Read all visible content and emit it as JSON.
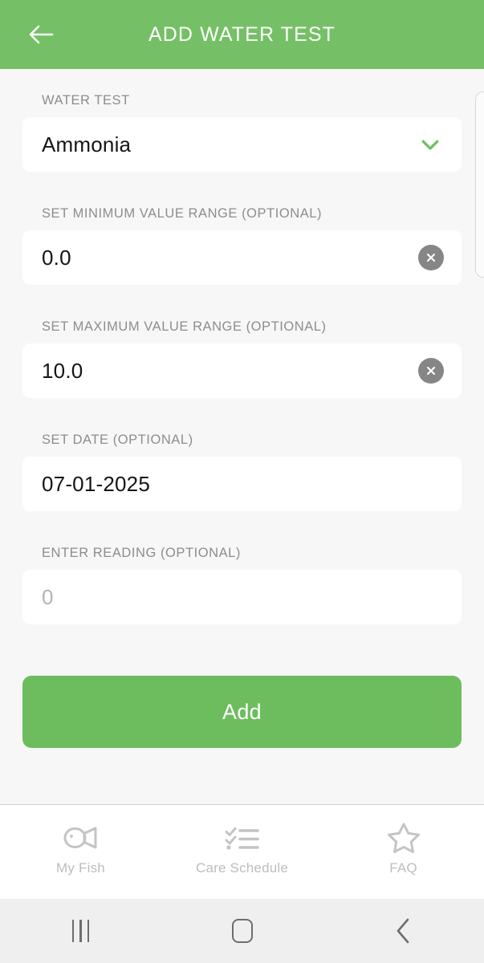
{
  "header": {
    "title": "ADD WATER TEST",
    "back_icon": "arrow-left-icon",
    "background_color": "#75c066"
  },
  "form": {
    "water_test": {
      "label": "WATER TEST",
      "value": "Ammonia",
      "dropdown_icon": "chevron-down-icon",
      "dropdown_icon_color": "#6dbd5f"
    },
    "min_value": {
      "label": "SET MINIMUM VALUE RANGE (OPTIONAL)",
      "value": "0.0",
      "clear_icon": "clear-circle-icon"
    },
    "max_value": {
      "label": "SET MAXIMUM VALUE RANGE (OPTIONAL)",
      "value": "10.0",
      "clear_icon": "clear-circle-icon"
    },
    "date": {
      "label": "SET DATE (OPTIONAL)",
      "value": "07-01-2025"
    },
    "reading": {
      "label": "ENTER READING (OPTIONAL)",
      "value": "",
      "placeholder": "0"
    },
    "submit_label": "Add",
    "submit_color": "#6dbd5f"
  },
  "tabbar": {
    "items": [
      {
        "label": "My Fish",
        "icon": "fish-icon"
      },
      {
        "label": "Care Schedule",
        "icon": "checklist-icon"
      },
      {
        "label": "FAQ",
        "icon": "star-icon"
      }
    ],
    "inactive_color": "#bdbdbd"
  },
  "system_nav": {
    "recents_icon": "recents-bars-icon",
    "home_icon": "home-square-icon",
    "back_icon": "chevron-left-icon"
  }
}
